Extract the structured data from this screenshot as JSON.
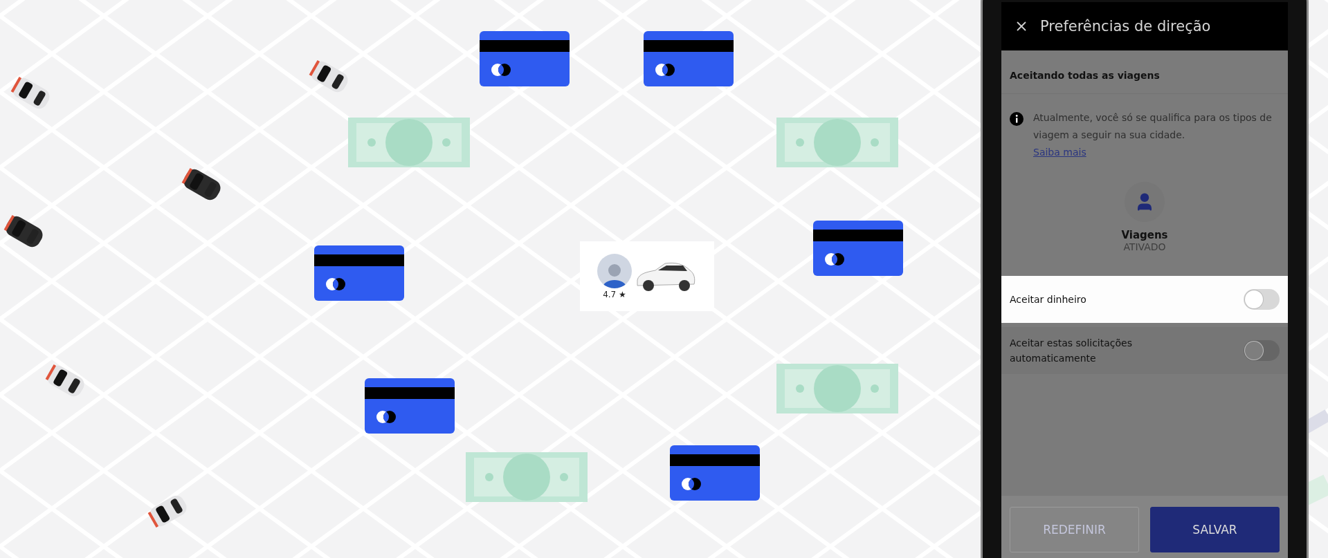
{
  "map": {
    "markers": [
      {
        "kind": "card"
      },
      {
        "kind": "card"
      },
      {
        "kind": "card"
      },
      {
        "kind": "card"
      },
      {
        "kind": "card"
      },
      {
        "kind": "card"
      },
      {
        "kind": "cash"
      },
      {
        "kind": "cash"
      },
      {
        "kind": "cash"
      },
      {
        "kind": "cash"
      },
      {
        "kind": "car",
        "color": "#e4e4e6"
      },
      {
        "kind": "car",
        "color": "#2b2b2b"
      },
      {
        "kind": "car",
        "color": "#e4e4e6"
      },
      {
        "kind": "car",
        "color": "#2b2b2b"
      },
      {
        "kind": "car",
        "color": "#e4e4e6"
      },
      {
        "kind": "car",
        "color": "#e4e4e6"
      }
    ],
    "driver": {
      "rating": "4.7",
      "star": "★"
    }
  },
  "phone": {
    "title": "Preferências de direção",
    "section_title": "Aceitando todas as viagens",
    "info": {
      "text": "Atualmente, você só se qualifica para os tipos de viagem a seguir na sua cidade.",
      "link": "Saiba mais"
    },
    "trip_type": {
      "name": "Viagens",
      "status": "ATIVADO"
    },
    "settings": [
      {
        "label": "Aceitar dinheiro",
        "on": false,
        "highlighted": true
      },
      {
        "label": "Aceitar estas solicitações automaticamente",
        "on": false,
        "highlighted": false
      }
    ],
    "buttons": [
      {
        "label": "REDEFINIR",
        "disabled": true
      },
      {
        "label": "SALVAR",
        "disabled": false
      }
    ]
  }
}
